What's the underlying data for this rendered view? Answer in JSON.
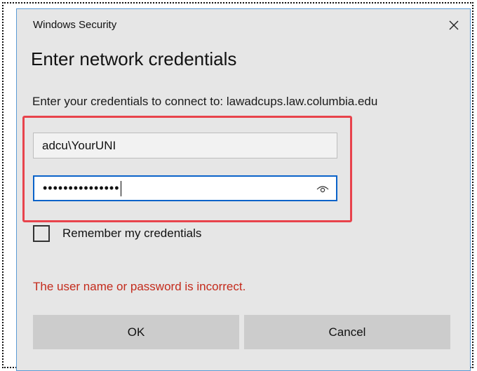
{
  "dialog": {
    "window_title": "Windows Security",
    "title": "Enter network credentials",
    "connect_text": "Enter your credentials to connect to: lawadcups.law.columbia.edu",
    "username_value": "adcu\\YourUNI",
    "password_masked": "•••••••••••••••",
    "remember_label": "Remember my credentials",
    "remember_checked": false,
    "error_message": "The user name or password is incorrect.",
    "ok_label": "OK",
    "cancel_label": "Cancel"
  },
  "icons": {
    "close": "close-icon",
    "reveal_password": "eye-icon"
  },
  "colors": {
    "dialog_bg": "#e6e6e6",
    "error": "#c42b1c",
    "focus_border": "#0a63c9",
    "highlight": "#e8434c"
  }
}
